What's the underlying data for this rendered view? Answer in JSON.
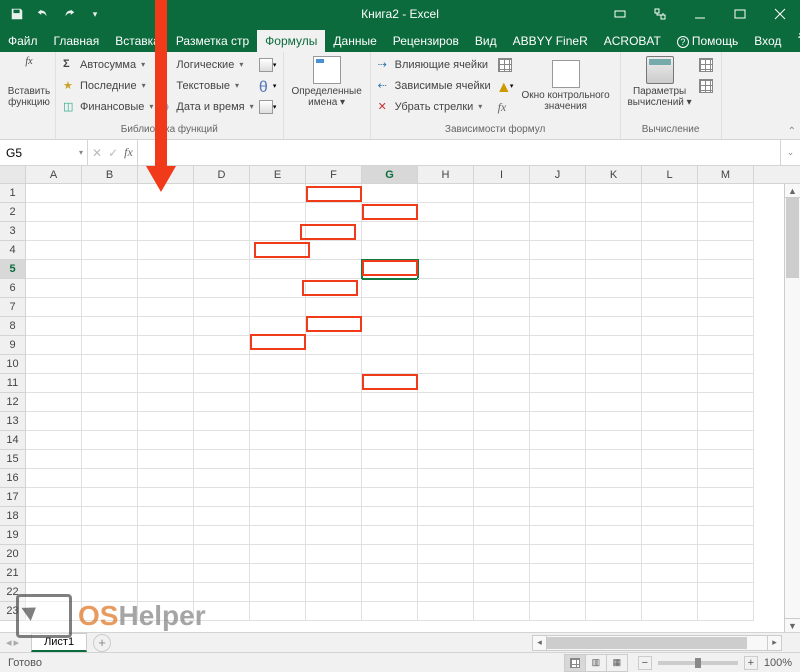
{
  "app": {
    "title": "Книга2 - Excel"
  },
  "tabs": {
    "file": "Файл",
    "items": [
      "Главная",
      "Вставка",
      "Разметка стр",
      "Формулы",
      "Данные",
      "Рецензиров",
      "Вид",
      "ABBYY FineR",
      "ACROBAT"
    ],
    "active": "Формулы",
    "help_icon": "?",
    "help": "Помощь",
    "signin": "Вход",
    "share": "Общий доступ"
  },
  "ribbon": {
    "insert_fn": {
      "l1": "Вставить",
      "l2": "функцию"
    },
    "lib": {
      "autosum": "Автосумма",
      "recent": "Последние",
      "financial": "Финансовые",
      "logical": "Логические",
      "text": "Текстовые",
      "datetime": "Дата и время",
      "label": "Библиотека функций"
    },
    "names": {
      "l1": "Определенные",
      "l2": "имена"
    },
    "audit": {
      "precedents": "Влияющие ячейки",
      "dependents": "Зависимые ячейки",
      "remove": "Убрать стрелки",
      "watch_l1": "Окно контрольного",
      "watch_l2": "значения",
      "label": "Зависимости формул"
    },
    "calc": {
      "l1": "Параметры",
      "l2": "вычислений",
      "label": "Вычисление"
    }
  },
  "formula_bar": {
    "namebox": "G5",
    "fx": "fx",
    "value": ""
  },
  "grid": {
    "cols": [
      "A",
      "B",
      "C",
      "D",
      "E",
      "F",
      "G",
      "H",
      "I",
      "J",
      "K",
      "L",
      "M"
    ],
    "rows": 23,
    "active_col": "G",
    "active_row": 5
  },
  "sheets": {
    "tab": "Лист1"
  },
  "status": {
    "ready": "Готово",
    "zoom": "100%"
  },
  "watermark": {
    "a": "OS",
    "b": "Helper"
  }
}
